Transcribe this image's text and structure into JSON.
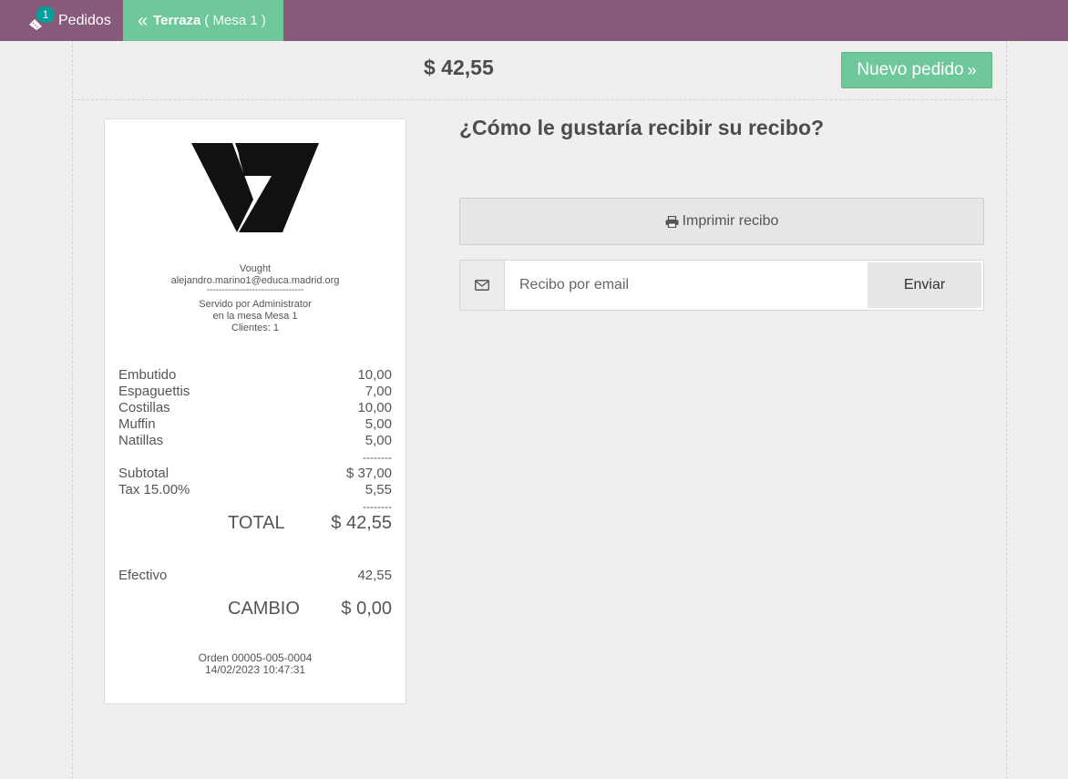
{
  "topbar": {
    "orders_count": "1",
    "orders_label": "Pedidos",
    "floor_name": "Terraza",
    "table_label": "( Mesa 1 )"
  },
  "header": {
    "total": "$ 42,55",
    "next_order_label": "Nuevo pedido"
  },
  "receipt": {
    "company": "Vought",
    "email": "alejandro.marino1@educa.madrid.org",
    "separator": "--------------------------------",
    "served_by": "Servido por Administrator",
    "table": "en la mesa Mesa 1",
    "guests": "Clientes: 1",
    "lines": [
      {
        "name": "Embutido",
        "price": "10,00"
      },
      {
        "name": "Espaguettis",
        "price": "7,00"
      },
      {
        "name": "Costillas",
        "price": "10,00"
      },
      {
        "name": "Muffin",
        "price": "5,00"
      },
      {
        "name": "Natillas",
        "price": "5,00"
      }
    ],
    "dash": "--------",
    "subtotal_label": "Subtotal",
    "subtotal_value": "$ 37,00",
    "tax_label": "Tax 15.00%",
    "tax_value": "5,55",
    "total_label": "TOTAL",
    "total_value": "$ 42,55",
    "payment_label": "Efectivo",
    "payment_value": "42,55",
    "change_label": "CAMBIO",
    "change_value": "$ 0,00",
    "order_ref": "Orden 00005-005-0004",
    "datetime": "14/02/2023 10:47:31"
  },
  "panel": {
    "question": "¿Cómo le gustaría recibir su recibo?",
    "print_label": "Imprimir recibo",
    "email_placeholder": "Recibo por email",
    "send_label": "Enviar"
  },
  "colors": {
    "topbar": "#875a7b",
    "accent_green": "#6ec89b",
    "badge": "#00a09d"
  },
  "icons": [
    "ticket-icon",
    "double-chevron-left-icon",
    "double-chevron-right-icon",
    "print-icon",
    "envelope-icon",
    "company-logo"
  ]
}
